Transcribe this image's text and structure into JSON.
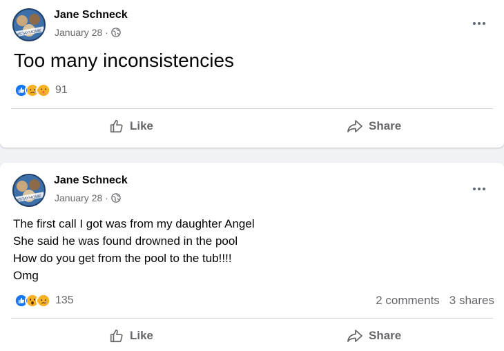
{
  "posts": [
    {
      "author": "Jane Schneck",
      "date": "January 28 ·",
      "text_lines": [
        "Too many inconsistencies"
      ],
      "reaction_count": "91",
      "reactions": [
        "like",
        "sad",
        "care"
      ],
      "comments": "",
      "shares": "",
      "like_label": "Like",
      "share_label": "Share"
    },
    {
      "author": "Jane Schneck",
      "date": "January 28 ·",
      "text_lines": [
        "The first call I got was from my daughter Angel",
        "She said he was found drowned in the pool",
        "How do you get from the pool to the tub!!!!",
        "Omg"
      ],
      "reaction_count": "135",
      "reactions": [
        "like",
        "wow",
        "sad"
      ],
      "comments": "2 comments",
      "shares": "3 shares",
      "like_label": "Like",
      "share_label": "Share"
    }
  ],
  "avatar_text": "#STAYHOME",
  "icons": {
    "privacy": "globe-icon",
    "more": "more-options-icon",
    "like": "thumbs-up-icon",
    "share": "share-arrow-icon"
  },
  "colors": {
    "like_blue": "#1877f2",
    "sad_yellow": "#f7b125",
    "secondary_text": "#65676b"
  }
}
